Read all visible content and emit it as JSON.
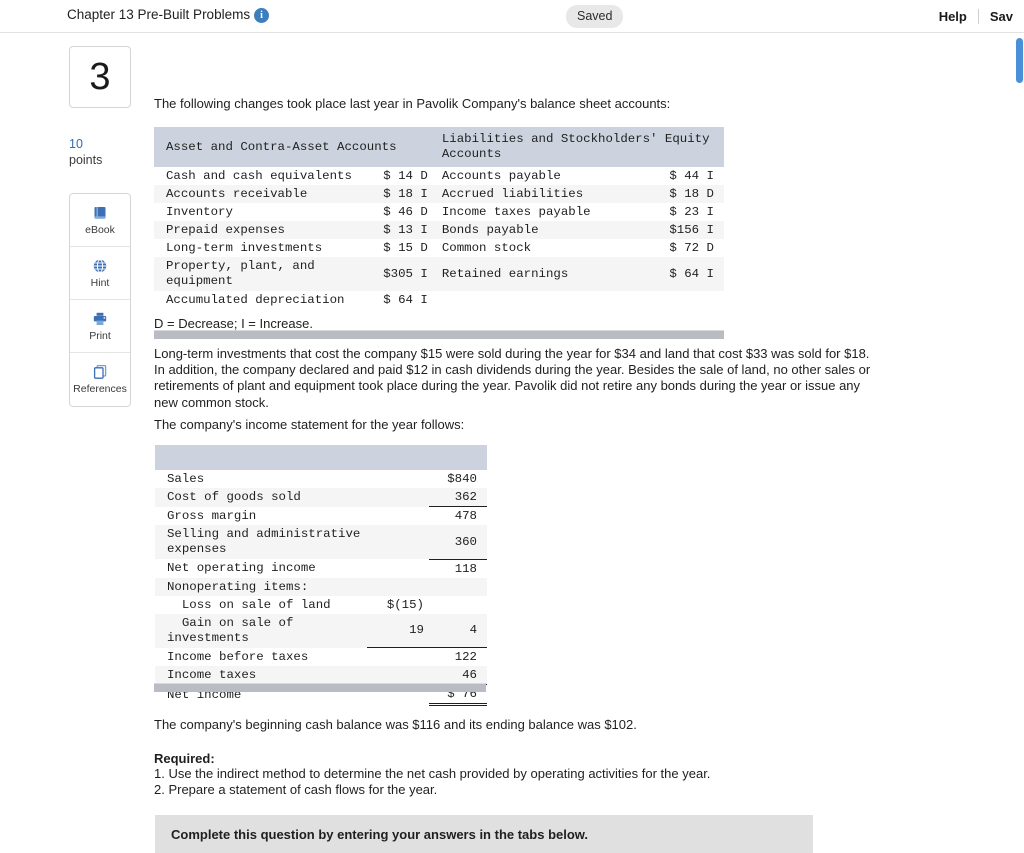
{
  "topbar": {
    "title": "Chapter 13 Pre-Built Problems",
    "info_icon": "info-icon",
    "status_badge": "Saved",
    "help_label": "Help",
    "save_label": "Sav"
  },
  "rail": {
    "question_number": "3",
    "points_value": "10",
    "points_label": "points",
    "tools": [
      {
        "label": "eBook",
        "icon": "book-icon"
      },
      {
        "label": "Hint",
        "icon": "globe-icon"
      },
      {
        "label": "Print",
        "icon": "printer-icon"
      },
      {
        "label": "References",
        "icon": "copy-icon"
      }
    ]
  },
  "main": {
    "intro": "The following changes took place last year in Pavolik Company's balance sheet accounts:",
    "legend": "D = Decrease; I = Increase.",
    "narrative": "Long-term investments that cost the company $15 were sold during the year for $34 and land that cost $33 was sold for $18. In addition, the company declared and paid $12 in cash dividends during the year. Besides the sale of land, no other sales or retirements of plant and equipment took place during the year. Pavolik did not retire any bonds during the year or issue any new common stock.",
    "income_intro": "The company's income statement for the year follows:",
    "cash_balance": "The company's beginning cash balance was $116 and its ending balance was $102.",
    "required_heading": "Required:",
    "required_items": [
      "1. Use the indirect method to determine the net cash provided by operating activities for the year.",
      "2. Prepare a statement of cash flows for the year."
    ],
    "banner": "Complete this question by entering your answers in the tabs below."
  },
  "balance_table": {
    "headers": [
      "Asset and Contra-Asset Accounts",
      "Liabilities and Stockholders' Equity Accounts"
    ],
    "rows": [
      {
        "asset": "Cash and cash equivalents",
        "asset_amt": "$ 14 D",
        "liab": "Accounts payable",
        "liab_amt": "$ 44 I"
      },
      {
        "asset": "Accounts receivable",
        "asset_amt": "$ 18 I",
        "liab": "Accrued liabilities",
        "liab_amt": "$ 18 D"
      },
      {
        "asset": "Inventory",
        "asset_amt": "$ 46 D",
        "liab": "Income taxes payable",
        "liab_amt": "$ 23 I"
      },
      {
        "asset": "Prepaid expenses",
        "asset_amt": "$ 13 I",
        "liab": "Bonds payable",
        "liab_amt": "$156 I"
      },
      {
        "asset": "Long-term investments",
        "asset_amt": "$ 15 D",
        "liab": "Common stock",
        "liab_amt": "$ 72 D"
      },
      {
        "asset": "Property, plant, and equipment",
        "asset_amt": "$305 I",
        "liab": "Retained earnings",
        "liab_amt": "$ 64 I"
      },
      {
        "asset": "Accumulated depreciation",
        "asset_amt": "$ 64 I",
        "liab": "",
        "liab_amt": ""
      }
    ]
  },
  "income_statement": {
    "rows": [
      {
        "label": "Sales",
        "n1": "",
        "n2": "$840",
        "rule": "none"
      },
      {
        "label": "Cost of goods sold",
        "n1": "",
        "n2": "362",
        "rule": "n2-single"
      },
      {
        "label": "Gross margin",
        "n1": "",
        "n2": "478",
        "rule": "none"
      },
      {
        "label": "Selling and administrative expenses",
        "n1": "",
        "n2": "360",
        "rule": "n2-single"
      },
      {
        "label": "Net operating income",
        "n1": "",
        "n2": "118",
        "rule": "none"
      },
      {
        "label": "Nonoperating items:",
        "n1": "",
        "n2": "",
        "rule": "none"
      },
      {
        "label": "  Loss on sale of land",
        "n1": "$(15)",
        "n2": "",
        "rule": "none"
      },
      {
        "label": "  Gain on sale of investments",
        "n1": "19",
        "n2": "4",
        "rule": "both-single"
      },
      {
        "label": "Income before taxes",
        "n1": "",
        "n2": "122",
        "rule": "none"
      },
      {
        "label": "Income taxes",
        "n1": "",
        "n2": "46",
        "rule": "n2-single"
      },
      {
        "label": "Net income",
        "n1": "",
        "n2": "$ 76",
        "rule": "n2-double"
      }
    ]
  },
  "colors": {
    "header_fill": "#ccd3de",
    "zebra": "#f5f5f5",
    "accent_blue": "#2c6fb5",
    "banner": "#e0e0e0",
    "scrollbar_blue": "#4a90d9"
  }
}
